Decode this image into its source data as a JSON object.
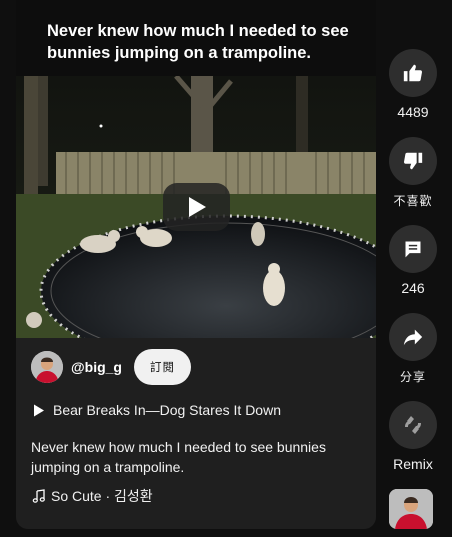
{
  "video": {
    "overlay_caption": "Never knew how much I needed to see bunnies jumping on a trampoline."
  },
  "channel": {
    "handle": "@big_g",
    "subscribe_label": "訂閱"
  },
  "linked_video": {
    "title": "Bear Breaks In—Dog Stares It Down"
  },
  "description": "Never knew how much I needed to see bunnies jumping on a trampoline.",
  "music": {
    "label": "So Cute · 김성환"
  },
  "actions": {
    "like_count": "4489",
    "dislike_label": "不喜歡",
    "comment_count": "246",
    "share_label": "分享",
    "remix_label": "Remix"
  },
  "colors": {
    "background": "#0f0f0f",
    "card": "#1f1f1f",
    "action_circle": "#2e2e2e",
    "subscribe_bg": "#f1f1f1"
  },
  "icons": {
    "like": "thumbs-up-icon",
    "dislike": "thumbs-down-icon",
    "comment": "comment-icon",
    "share": "share-icon",
    "remix": "remix-icon",
    "play": "play-icon",
    "music": "music-note-icon"
  }
}
